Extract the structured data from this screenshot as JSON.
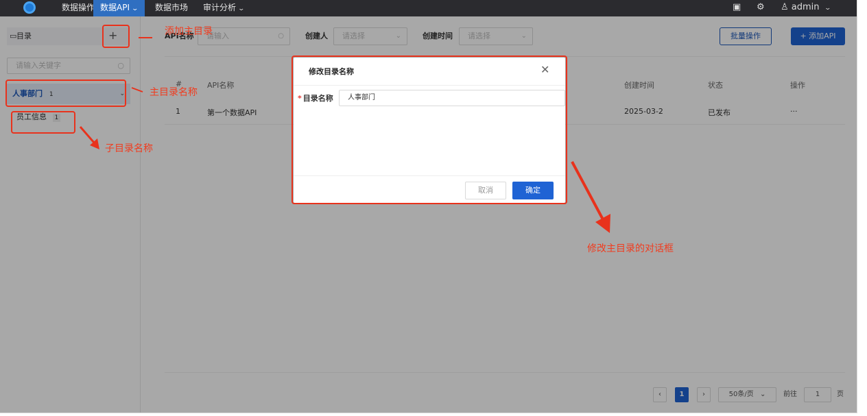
{
  "topbar": {
    "nav": [
      {
        "label": "数据操作",
        "active": false
      },
      {
        "label": "数据API",
        "active": true,
        "has_dropdown": true
      },
      {
        "label": "数据市场",
        "active": false
      },
      {
        "label": "审计分析",
        "active": false,
        "has_dropdown": true
      }
    ],
    "user": "admin"
  },
  "sidebar": {
    "header": "目录",
    "search_placeholder": "请输入关键字",
    "main_dir": {
      "label": "人事部门",
      "count": "1"
    },
    "sub_dir": {
      "label": "员工信息",
      "count": "1"
    }
  },
  "filters": {
    "api_name_label": "API名称",
    "api_name_placeholder": "请输入",
    "creator_label": "创建人",
    "creator_placeholder": "请选择",
    "created_time_label": "创建时间",
    "created_time_placeholder": "请选择",
    "batch_button": "批量操作",
    "add_button": "+ 添加API"
  },
  "table": {
    "columns": [
      "#",
      "API名称",
      "创建时间",
      "状态",
      "操作"
    ],
    "rows": [
      {
        "index": "1",
        "name": "第一个数据API",
        "created": "2025-03-2",
        "status": "已发布",
        "ops": "···"
      }
    ]
  },
  "pagination": {
    "current_page": "1",
    "page_size": "50条/页",
    "goto_label": "前往",
    "goto_value": "1",
    "page_unit": "页"
  },
  "dialog": {
    "title": "修改目录名称",
    "field_label": "目录名称",
    "field_value": "人事部门",
    "cancel": "取消",
    "confirm": "确定"
  },
  "annotations": {
    "add_main_dir": "添加主目录",
    "main_dir_name": "主目录名称",
    "sub_dir_name": "子目录名称",
    "edit_dialog": "修改主目录的对话框"
  },
  "colors": {
    "accent": "#1f63d4",
    "annotation": "#e8321c",
    "topbar": "#2b2b2f"
  }
}
